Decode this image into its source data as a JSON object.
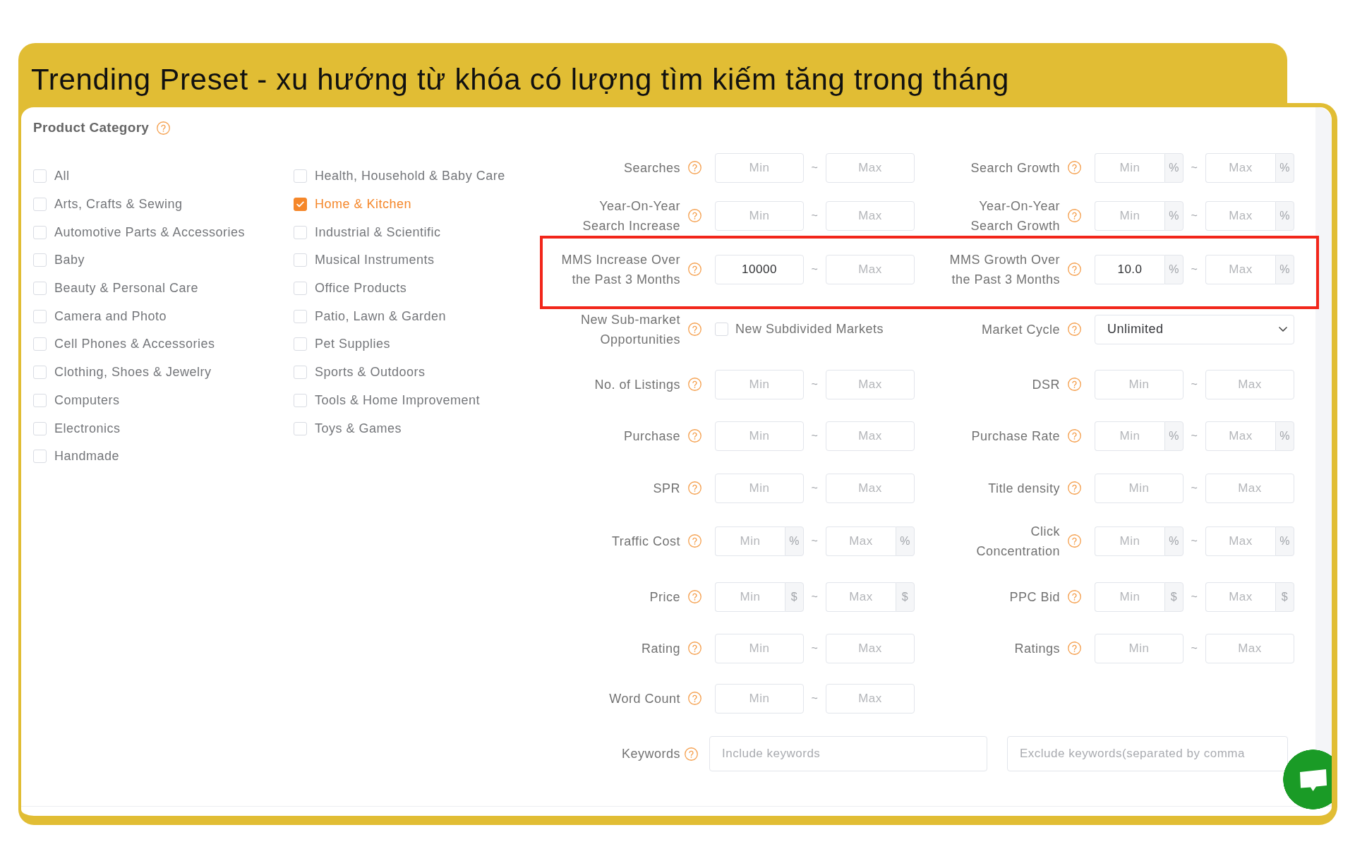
{
  "banner": {
    "title": "Trending Preset - xu hướng từ khóa có lượng tìm kiếm tăng trong tháng"
  },
  "product_category": {
    "title": "Product Category",
    "columns": [
      {
        "items": [
          {
            "label": "All",
            "checked": false
          },
          {
            "label": "Arts, Crafts & Sewing",
            "checked": false
          },
          {
            "label": "Automotive Parts & Accessories",
            "checked": false
          },
          {
            "label": "Baby",
            "checked": false
          },
          {
            "label": "Beauty & Personal Care",
            "checked": false
          },
          {
            "label": "Camera and Photo",
            "checked": false
          },
          {
            "label": "Cell Phones & Accessories",
            "checked": false
          },
          {
            "label": "Clothing, Shoes & Jewelry",
            "checked": false
          },
          {
            "label": "Computers",
            "checked": false
          },
          {
            "label": "Electronics",
            "checked": false
          },
          {
            "label": "Handmade",
            "checked": false
          }
        ]
      },
      {
        "items": [
          {
            "label": "Health, Household & Baby Care",
            "checked": false
          },
          {
            "label": "Home & Kitchen",
            "checked": true
          },
          {
            "label": "Industrial & Scientific",
            "checked": false
          },
          {
            "label": "Musical Instruments",
            "checked": false
          },
          {
            "label": "Office Products",
            "checked": false
          },
          {
            "label": "Patio, Lawn & Garden",
            "checked": false
          },
          {
            "label": "Pet Supplies",
            "checked": false
          },
          {
            "label": "Sports & Outdoors",
            "checked": false
          },
          {
            "label": "Tools & Home Improvement",
            "checked": false
          },
          {
            "label": "Toys & Games",
            "checked": false
          }
        ]
      }
    ]
  },
  "filter_rows": [
    {
      "highlighted": false,
      "filters": [
        {
          "kind": "range",
          "label": "Searches",
          "min": {
            "placeholder": "Min"
          },
          "separator": "~",
          "max": {
            "placeholder": "Max"
          }
        },
        {
          "kind": "range",
          "label": "Search Growth",
          "min": {
            "placeholder": "Min",
            "unit": "%"
          },
          "separator": "~",
          "max": {
            "placeholder": "Max",
            "unit": "%"
          }
        }
      ]
    },
    {
      "highlighted": false,
      "filters": [
        {
          "kind": "range",
          "label": "Year-On-Year Search Increase",
          "min": {
            "placeholder": "Min"
          },
          "separator": "~",
          "max": {
            "placeholder": "Max"
          }
        },
        {
          "kind": "range",
          "label": "Year-On-Year Search Growth",
          "min": {
            "placeholder": "Min",
            "unit": "%"
          },
          "separator": "~",
          "max": {
            "placeholder": "Max",
            "unit": "%"
          }
        }
      ]
    },
    {
      "highlighted": true,
      "filters": [
        {
          "kind": "range",
          "label": "MMS Increase Over the Past 3 Months",
          "min": {
            "value": "10000"
          },
          "separator": "~",
          "max": {
            "placeholder": "Max"
          }
        },
        {
          "kind": "range",
          "label": "MMS Growth Over the Past 3 Months",
          "min": {
            "value": "10.0",
            "unit": "%"
          },
          "separator": "~",
          "max": {
            "placeholder": "Max",
            "unit": "%"
          }
        }
      ]
    },
    {
      "highlighted": false,
      "filters": [
        {
          "kind": "checkbox",
          "label": "New Sub-market Opportunities",
          "option": {
            "label": "New Subdivided Markets",
            "checked": false
          }
        },
        {
          "kind": "select",
          "label": "Market Cycle",
          "value": "Unlimited"
        }
      ]
    },
    {
      "highlighted": false,
      "filters": [
        {
          "kind": "range",
          "label": "No. of Listings",
          "min": {
            "placeholder": "Min"
          },
          "separator": "~",
          "max": {
            "placeholder": "Max"
          }
        },
        {
          "kind": "range",
          "label": "DSR",
          "min": {
            "placeholder": "Min"
          },
          "separator": "~",
          "max": {
            "placeholder": "Max"
          }
        }
      ]
    },
    {
      "highlighted": false,
      "filters": [
        {
          "kind": "range",
          "label": "Purchase",
          "min": {
            "placeholder": "Min"
          },
          "separator": "~",
          "max": {
            "placeholder": "Max"
          }
        },
        {
          "kind": "range",
          "label": "Purchase Rate",
          "min": {
            "placeholder": "Min",
            "unit": "%"
          },
          "separator": "~",
          "max": {
            "placeholder": "Max",
            "unit": "%"
          }
        }
      ]
    },
    {
      "highlighted": false,
      "filters": [
        {
          "kind": "range",
          "label": "SPR",
          "min": {
            "placeholder": "Min"
          },
          "separator": "~",
          "max": {
            "placeholder": "Max"
          }
        },
        {
          "kind": "range",
          "label": "Title density",
          "min": {
            "placeholder": "Min"
          },
          "separator": "~",
          "max": {
            "placeholder": "Max"
          }
        }
      ]
    },
    {
      "highlighted": false,
      "filters": [
        {
          "kind": "range",
          "label": "Traffic Cost",
          "min": {
            "placeholder": "Min",
            "unit": "%"
          },
          "separator": "~",
          "max": {
            "placeholder": "Max",
            "unit": "%"
          }
        },
        {
          "kind": "range",
          "label": "Click Concentration",
          "min": {
            "placeholder": "Min",
            "unit": "%"
          },
          "separator": "~",
          "max": {
            "placeholder": "Max",
            "unit": "%"
          }
        }
      ]
    },
    {
      "highlighted": false,
      "filters": [
        {
          "kind": "range",
          "label": "Price",
          "min": {
            "placeholder": "Min",
            "unit": "$"
          },
          "separator": "~",
          "max": {
            "placeholder": "Max",
            "unit": "$"
          }
        },
        {
          "kind": "range",
          "label": "PPC Bid",
          "min": {
            "placeholder": "Min",
            "unit": "$"
          },
          "separator": "~",
          "max": {
            "placeholder": "Max",
            "unit": "$"
          }
        }
      ]
    },
    {
      "highlighted": false,
      "filters": [
        {
          "kind": "range",
          "label": "Rating",
          "min": {
            "placeholder": "Min"
          },
          "separator": "~",
          "max": {
            "placeholder": "Max"
          }
        },
        {
          "kind": "range",
          "label": "Ratings",
          "min": {
            "placeholder": "Min"
          },
          "separator": "~",
          "max": {
            "placeholder": "Max"
          }
        }
      ]
    },
    {
      "highlighted": false,
      "filters": [
        {
          "kind": "range",
          "label": "Word Count",
          "min": {
            "placeholder": "Min"
          },
          "separator": "~",
          "max": {
            "placeholder": "Max"
          }
        }
      ]
    }
  ],
  "keywords": {
    "label": "Keywords",
    "include": {
      "placeholder": "Include keywords"
    },
    "exclude": {
      "placeholder": "Exclude keywords(separated by comma"
    }
  }
}
